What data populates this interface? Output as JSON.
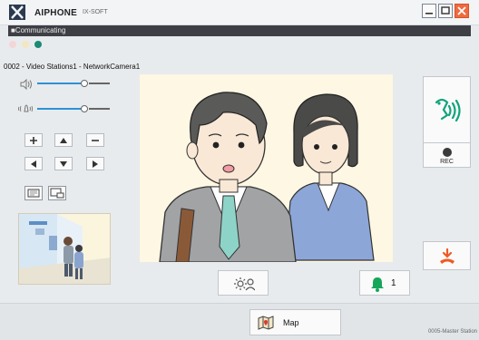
{
  "window": {
    "brand": "AIPHONE",
    "brand_sub": "IX-SOFT",
    "status": "■Communicating"
  },
  "station": {
    "line": "0002 - Video Stations1 - NetworkCamera1"
  },
  "controls": {
    "rec_label": "REC",
    "page_count": "1",
    "map_label": "Map"
  },
  "footer": {
    "station_name": "0005-Master Station"
  },
  "colors": {
    "status_bar": "#3d3f45",
    "accent_blue": "#2b92d6",
    "talk_green": "#12a37b",
    "bell_green": "#14a65a",
    "hangup_orange": "#ef5a24",
    "close_button": "#ef6b3f"
  },
  "icons": {
    "talk": "talk-icon",
    "record": "record-icon",
    "hangup": "hangup-icon",
    "brightness": "brightness-icon",
    "bell": "bell-icon",
    "map": "map-icon"
  }
}
